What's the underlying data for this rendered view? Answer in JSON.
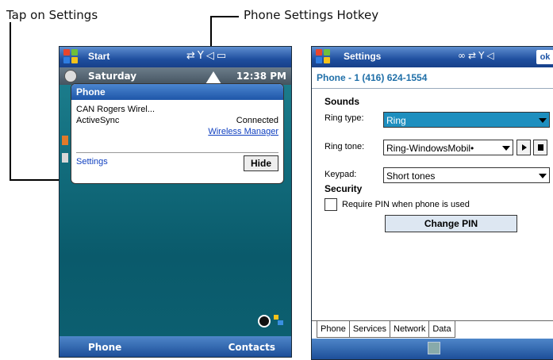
{
  "callouts": {
    "tap_settings": "Tap on Settings",
    "hotkey": "Phone Settings Hotkey"
  },
  "left_screen": {
    "titlebar": {
      "title": "Start",
      "status_icons": [
        "data-connection-icon",
        "signal-icon",
        "speaker-icon",
        "battery-icon"
      ]
    },
    "today": {
      "day": "Saturday",
      "time": "12:38 PM"
    },
    "popup": {
      "title": "Phone",
      "carrier": "CAN Rogers Wirel...",
      "activesync_label": "ActiveSync",
      "activesync_status": "Connected",
      "wireless_manager_link": "Wireless Manager",
      "settings_link": "Settings",
      "hide_button": "Hide"
    },
    "bottom": {
      "left_soft_key": "Phone",
      "right_soft_key": "Contacts"
    }
  },
  "right_screen": {
    "titlebar": {
      "title": "Settings",
      "ok_label": "ok"
    },
    "phone_number": "Phone - 1 (416) 624-1554",
    "sounds": {
      "heading": "Sounds",
      "ring_type_label": "Ring type:",
      "ring_type_value": "Ring",
      "ring_tone_label": "Ring tone:",
      "ring_tone_value": "Ring-WindowsMobil•",
      "keypad_label": "Keypad:",
      "keypad_value": "Short tones"
    },
    "security": {
      "heading": "Security",
      "require_pin_label": "Require PIN when phone is used",
      "require_pin_checked": false,
      "change_pin_button": "Change PIN"
    },
    "tabs": [
      "Phone",
      "Services",
      "Network",
      "Data"
    ],
    "active_tab": "Phone"
  },
  "colors": {
    "titlebar_blue": "#1f4f9f",
    "today_teal": "#126d7d",
    "selected_combo": "#1e8fbf",
    "link_blue": "#1040c0"
  }
}
